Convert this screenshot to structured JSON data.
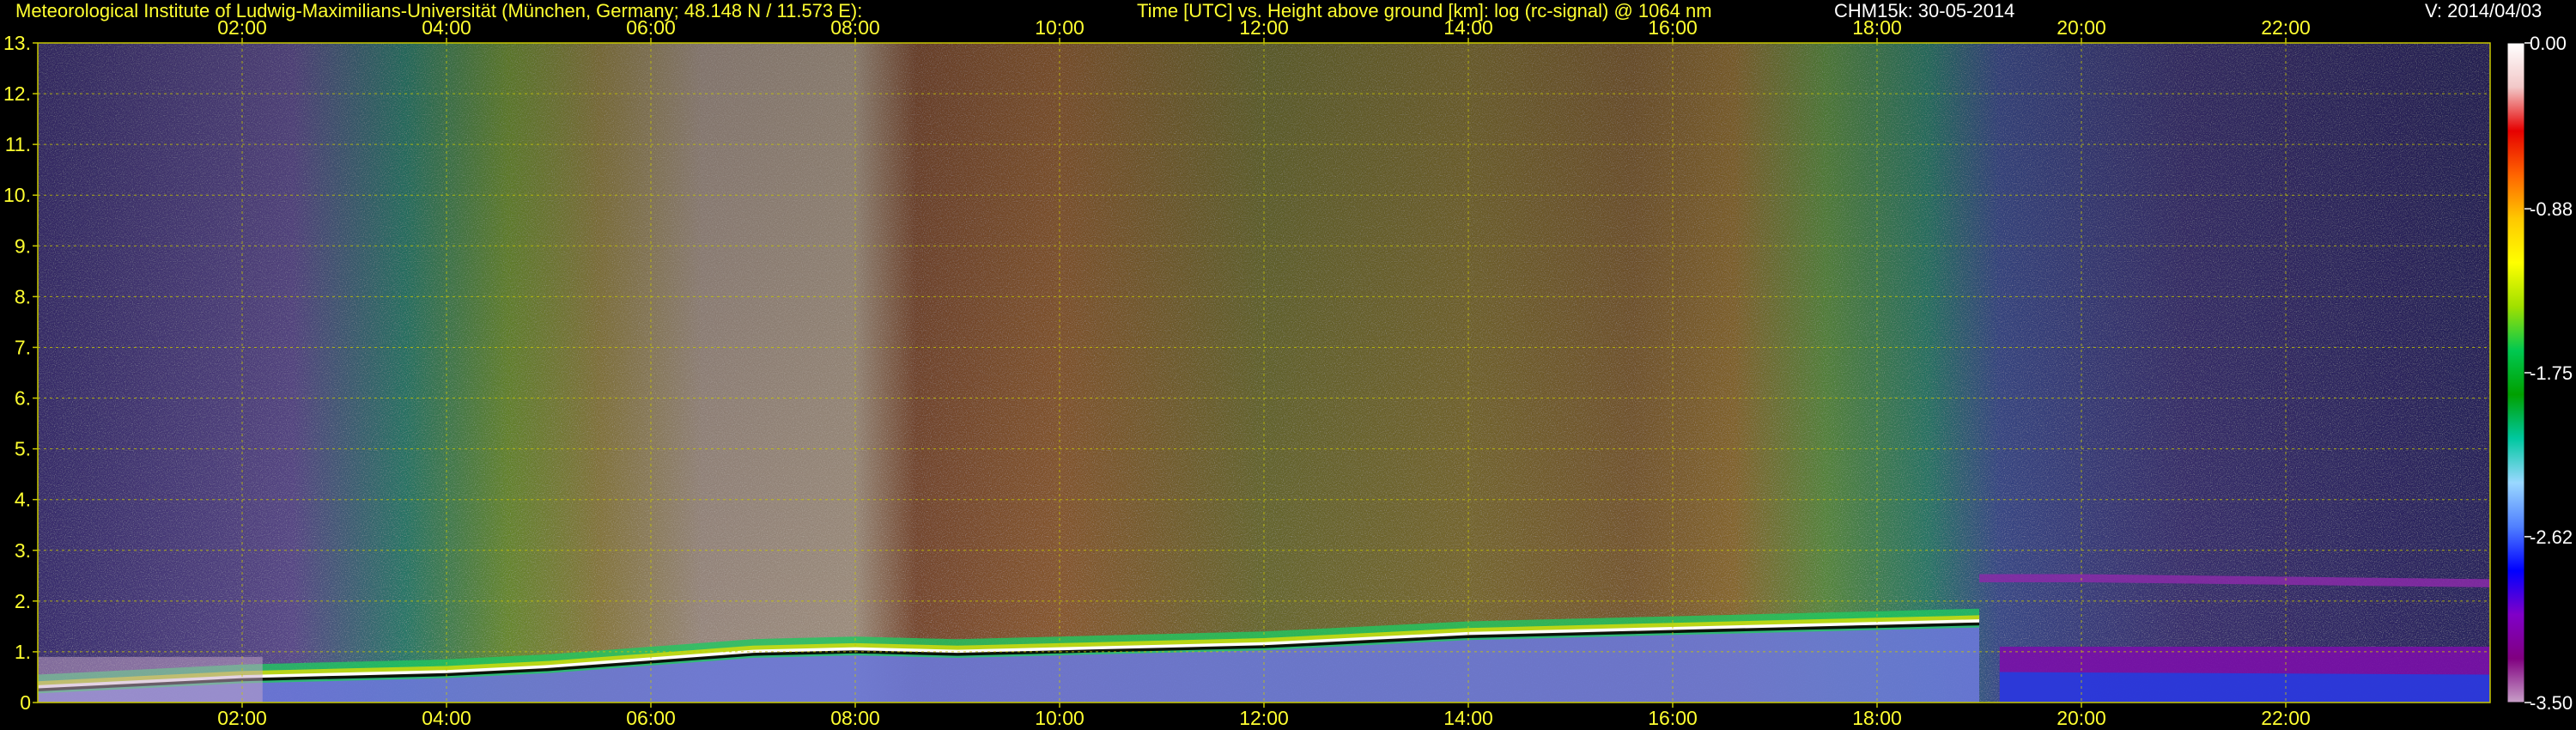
{
  "header": {
    "institute": "Meteorological Institute of Ludwig-Maximilians-Universität (München, Germany; 48.148 N / 11.573 E):",
    "plot_title": "Time [UTC] vs. Height above ground [km]: log (rc-signal) @ 1064 nm",
    "instrument_date": "CHM15k: 30-05-2014",
    "version": "V: 2014/04/03"
  },
  "chart_data": {
    "type": "heatmap",
    "title": "Time [UTC] vs. Height above ground [km]: log (rc-signal) @ 1064 nm",
    "xlabel": "Time [UTC]",
    "ylabel": "Height above ground [km]",
    "x_range_hours": [
      0,
      24
    ],
    "y_range_km": [
      0,
      13
    ],
    "x_ticks": [
      "02:00",
      "04:00",
      "06:00",
      "08:00",
      "10:00",
      "12:00",
      "14:00",
      "16:00",
      "18:00",
      "20:00",
      "22:00"
    ],
    "y_ticks": [
      "0",
      "1.",
      "2.",
      "3.",
      "4.",
      "5.",
      "6.",
      "7.",
      "8.",
      "9.",
      "10.",
      "11.",
      "12.",
      "13."
    ],
    "grid": true,
    "colorbar": {
      "range": [
        -3.5,
        0.0
      ],
      "tick_labels": [
        "0.00",
        "-0.88",
        "-1.75",
        "-2.62",
        "-3.50"
      ],
      "tick_values": [
        0.0,
        -0.88,
        -1.75,
        -2.62,
        -3.5
      ],
      "colors": [
        "#ffffff",
        "#f2c8c8",
        "#e60000",
        "#ff6400",
        "#ffc800",
        "#ffff00",
        "#a0e000",
        "#00c850",
        "#00a000",
        "#00c8a0",
        "#9ad8ff",
        "#5080ff",
        "#0000ff",
        "#8000c8",
        "#800080",
        "#c8a0c8"
      ]
    },
    "features": {
      "boundary_layer_top_km": [
        {
          "t": 0.0,
          "h": 0.3
        },
        {
          "t": 1.0,
          "h": 0.4
        },
        {
          "t": 2.0,
          "h": 0.5
        },
        {
          "t": 3.0,
          "h": 0.55
        },
        {
          "t": 4.0,
          "h": 0.6
        },
        {
          "t": 5.0,
          "h": 0.7
        },
        {
          "t": 6.0,
          "h": 0.85
        },
        {
          "t": 7.0,
          "h": 1.0
        },
        {
          "t": 8.0,
          "h": 1.05
        },
        {
          "t": 9.0,
          "h": 1.0
        },
        {
          "t": 10.0,
          "h": 1.05
        },
        {
          "t": 11.0,
          "h": 1.1
        },
        {
          "t": 12.0,
          "h": 1.15
        },
        {
          "t": 13.0,
          "h": 1.25
        },
        {
          "t": 14.0,
          "h": 1.35
        },
        {
          "t": 15.0,
          "h": 1.4
        },
        {
          "t": 16.0,
          "h": 1.45
        },
        {
          "t": 17.0,
          "h": 1.5
        },
        {
          "t": 18.0,
          "h": 1.55
        },
        {
          "t": 19.0,
          "h": 1.6
        }
      ],
      "residual_layer_km": [
        {
          "t": 19.0,
          "h": 2.45
        },
        {
          "t": 20.0,
          "h": 2.45
        },
        {
          "t": 22.0,
          "h": 2.4
        },
        {
          "t": 24.0,
          "h": 2.35
        }
      ]
    }
  }
}
